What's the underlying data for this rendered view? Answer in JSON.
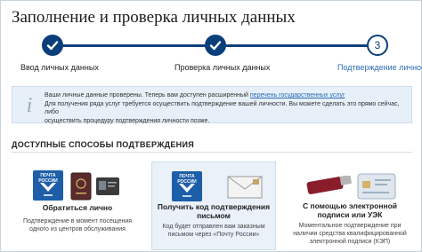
{
  "header": {
    "title": "Заполнение и проверка личных данных"
  },
  "steps": [
    {
      "label": "Ввод личных данных",
      "state": "done"
    },
    {
      "label": "Проверка личных данных",
      "state": "done"
    },
    {
      "label": "Подтверждение личности",
      "state": "current",
      "number": "3"
    }
  ],
  "info": {
    "line1_prefix": "Ваши личные данные проверены. Теперь вам доступен расширенный ",
    "line1_link": "перечень государственных услуг",
    "line2": "Для получения ряда услуг требуется осуществить подтверждение вашей личности. Вы можете сделать это прямо сейчас, либо",
    "line3": "осуществить процедуру подтверждения личности позже."
  },
  "section_title": "ДОСТУПНЫЕ СПОСОБЫ ПОДТВЕРЖДЕНИЯ",
  "methods": [
    {
      "title": "Обратиться лично",
      "desc": "Подтверждение в момент посещения одного из центров обслуживания",
      "logo_text": "ПОЧТА РОССИИ"
    },
    {
      "title": "Получить код подтверждения письмом",
      "desc": "Код будет отправлен вам заказным письмом через «Почту России»",
      "logo_text": "ПОЧТА РОССИИ"
    },
    {
      "title": "С помощью электронной подписи или УЭК",
      "desc": "Моментальное подтверждение при наличии средства квалифицированной электронной подписи (КЭП)"
    }
  ],
  "colors": {
    "brand": "#0b3f7a",
    "link": "#2a6cb6",
    "info_bg": "#e7f0f8",
    "post_blue": "#1c5ea8"
  }
}
